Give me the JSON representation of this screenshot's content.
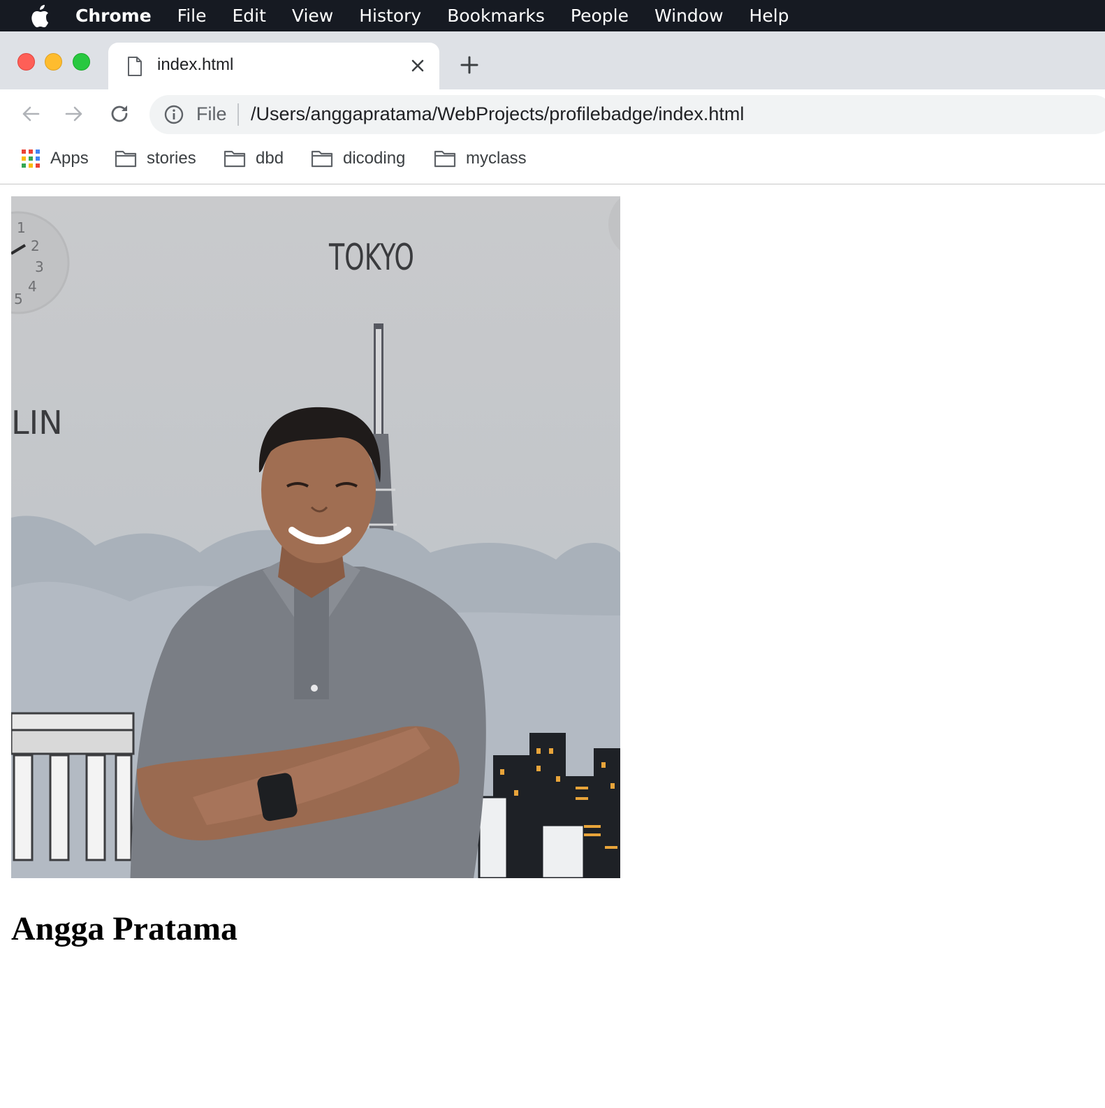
{
  "menubar": {
    "items": [
      "Chrome",
      "File",
      "Edit",
      "View",
      "History",
      "Bookmarks",
      "People",
      "Window",
      "Help"
    ]
  },
  "tab": {
    "title": "index.html"
  },
  "omnibox": {
    "scheme": "File",
    "url": "/Users/anggapratama/WebProjects/profilebadge/index.html"
  },
  "bookmarks": [
    {
      "label": "Apps",
      "icon": "apps-grid-icon"
    },
    {
      "label": "stories",
      "icon": "folder-icon"
    },
    {
      "label": "dbd",
      "icon": "folder-icon"
    },
    {
      "label": "dicoding",
      "icon": "folder-icon"
    },
    {
      "label": "myclass",
      "icon": "folder-icon"
    }
  ],
  "photo_text": {
    "sign_tokyo": "TOKYO",
    "sign_left": "LIN"
  },
  "profile": {
    "name": "Angga Pratama"
  },
  "colors": {
    "menubar_bg": "#161a22",
    "tabstrip_bg": "#dee1e6",
    "omnibox_bg": "#f1f3f4",
    "traffic_red": "#fe5f57",
    "traffic_yellow": "#febc2e",
    "traffic_green": "#28c840"
  }
}
